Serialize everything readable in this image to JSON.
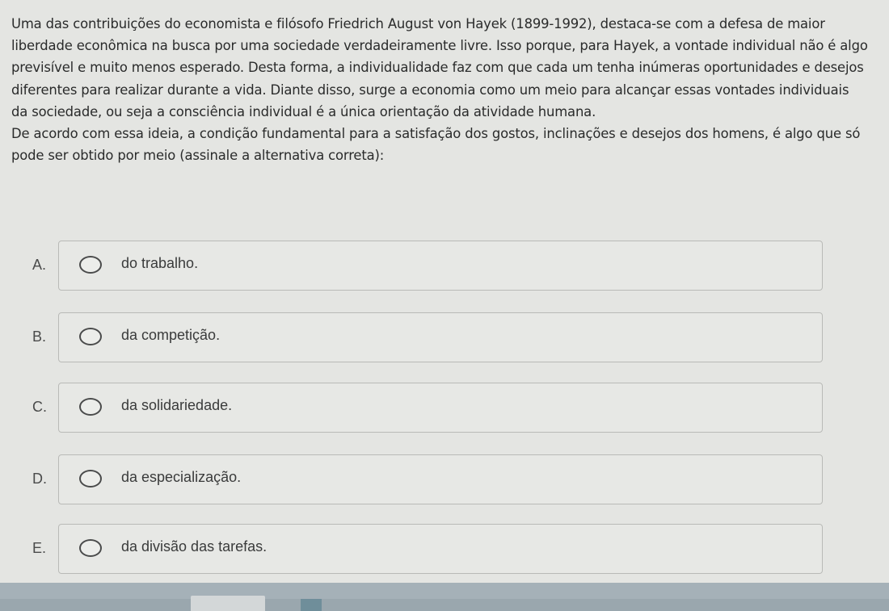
{
  "question": {
    "paragraph_1": "Uma das contribuições do economista e filósofo Friedrich August von Hayek (1899-1992), destaca-se com a defesa de maior liberdade econômica na busca por uma sociedade verdadeiramente livre. Isso porque, para Hayek, a vontade individual não é algo previsível e muito menos esperado. Desta forma, a individualidade faz com que cada um tenha inúmeras oportunidades e desejos diferentes para realizar durante a vida. Diante disso, surge a economia como um meio para alcançar essas vontades individuais da sociedade, ou seja a consciência individual é a única orientação da atividade humana.",
    "paragraph_2": "De acordo com essa ideia, a condição fundamental para a satisfação dos gostos, inclinações e desejos dos homens, é algo que só pode ser obtido por meio (assinale a alternativa correta):"
  },
  "options": [
    {
      "letter": "A.",
      "text": "do trabalho."
    },
    {
      "letter": "B.",
      "text": "da competição."
    },
    {
      "letter": "C.",
      "text": "da solidariedade."
    },
    {
      "letter": "D.",
      "text": "da especialização."
    },
    {
      "letter": "E.",
      "text": "da divisão das tarefas."
    }
  ]
}
